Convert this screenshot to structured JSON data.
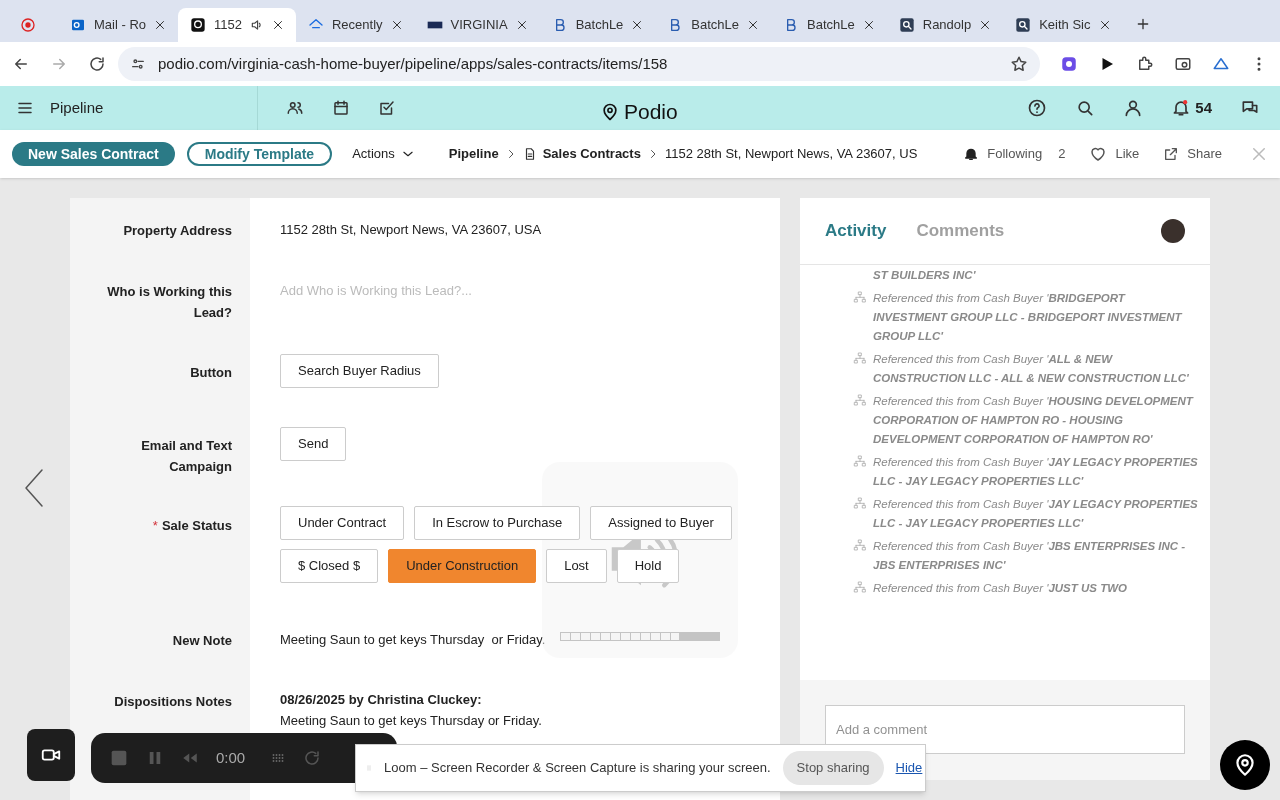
{
  "browser_tabs": [
    {
      "kind": "mail",
      "title": "Mail - Ro",
      "selected": false
    },
    {
      "kind": "podio",
      "title": "1152",
      "selected": true,
      "audio": true
    },
    {
      "kind": "zillow",
      "title": "Recently",
      "selected": false
    },
    {
      "kind": "scc",
      "title": "VIRGINIA",
      "selected": false
    },
    {
      "kind": "batch",
      "title": "BatchLe",
      "selected": false
    },
    {
      "kind": "batch",
      "title": "BatchLe",
      "selected": false
    },
    {
      "kind": "batch",
      "title": "BatchLe",
      "selected": false
    },
    {
      "kind": "search",
      "title": "Randolp",
      "selected": false
    },
    {
      "kind": "search",
      "title": "Keith Sic",
      "selected": false
    }
  ],
  "address_bar": {
    "url": "podio.com/virginia-cash-home-buyer/pipeline/apps/sales-contracts/items/158"
  },
  "app_header": {
    "workspace": "Pipeline",
    "logo": "Podio",
    "notifications": "54"
  },
  "action_bar": {
    "primary_button": "New Sales Contract",
    "secondary_button": "Modify Template",
    "actions": "Actions",
    "breadcrumbs": [
      "Pipeline",
      "Sales Contracts",
      "1152 28th St, Newport News, VA 23607, US"
    ],
    "following": "Following",
    "followers": "2",
    "like": "Like",
    "share": "Share"
  },
  "fields": [
    {
      "kind": "text",
      "label": "Property Address",
      "value": "1152 28th St, Newport News, VA 23607, USA"
    },
    {
      "kind": "placeholder",
      "label": "Who is Working this Lead?",
      "placeholder": "Add Who is Working this Lead?..."
    },
    {
      "kind": "button",
      "label": "Button",
      "button": "Search Buyer Radius"
    },
    {
      "kind": "button",
      "label": "Email and Text Campaign",
      "button": "Send"
    },
    {
      "kind": "options",
      "label": "Sale Status",
      "required_mark": "*",
      "options": [
        {
          "label": "Under Contract",
          "selected": false
        },
        {
          "label": "In Escrow to Purchase",
          "selected": false
        },
        {
          "label": "Assigned to Buyer",
          "selected": false
        },
        {
          "label": "$ Closed $",
          "selected": false
        },
        {
          "label": "Under Construction",
          "selected": true
        },
        {
          "label": "Lost",
          "selected": false
        },
        {
          "label": "Hold",
          "selected": false
        }
      ]
    },
    {
      "kind": "text",
      "label": "New Note",
      "value": "Meeting Saun to get keys Thursday  or Friday."
    },
    {
      "kind": "note",
      "label": "Dispositions Notes",
      "author": "08/26/2025 by Christina Cluckey:",
      "value": "Meeting Saun to get keys Thursday or Friday."
    }
  ],
  "activity_panel": {
    "tabs": [
      {
        "label": "Activity",
        "selected": true
      },
      {
        "label": "Comments",
        "selected": false
      }
    ],
    "items": [
      {
        "kind": "continuation",
        "text": "**ST BUILDERS INC'**"
      },
      {
        "kind": "reference",
        "text": "Referenced this from Cash Buyer '**BRIDGEPORT INVESTMENT GROUP LLC - BRIDGEPORT INVESTMENT GROUP LLC'**"
      },
      {
        "kind": "reference",
        "text": "Referenced this from Cash Buyer '**ALL & NEW CONSTRUCTION LLC - ALL & NEW CONSTRUCTION LLC'**"
      },
      {
        "kind": "reference",
        "text": "Referenced this from Cash Buyer '**HOUSING DEVELOPMENT CORPORATION OF HAMPTON RO - HOUSING DEVELOPMENT CORPORATION OF HAMPTON RO'**"
      },
      {
        "kind": "reference",
        "text": "Referenced this from Cash Buyer '**JAY LEGACY PROPERTIES LLC - JAY LEGACY PROPERTIES LLC'**"
      },
      {
        "kind": "reference",
        "text": "Referenced this from Cash Buyer '**JAY LEGACY PROPERTIES LLC - JAY LEGACY PROPERTIES LLC'**"
      },
      {
        "kind": "reference",
        "text": "Referenced this from Cash Buyer '**JBS ENTERPRISES INC - JBS ENTERPRISES INC'**"
      },
      {
        "kind": "reference",
        "text": "Referenced this from Cash Buyer '**JUST US TWO**"
      }
    ],
    "comment_placeholder": "Add a comment"
  },
  "volume_overlay": {
    "level": 0.75
  },
  "recorder": {
    "time": "0:00"
  },
  "sharing_bar": {
    "message": "Loom – Screen Recorder & Screen Capture is sharing your screen.",
    "stop": "Stop sharing",
    "hide": "Hide"
  }
}
